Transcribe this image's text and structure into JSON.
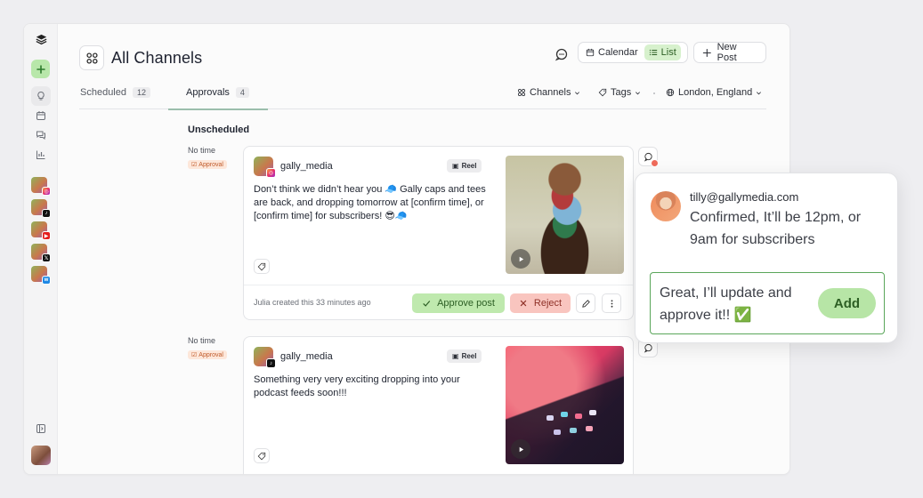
{
  "page": {
    "title": "All Channels"
  },
  "header": {
    "view_calendar": "Calendar",
    "view_list": "List",
    "new_post": "New Post"
  },
  "tabs": [
    {
      "label": "Scheduled",
      "count": "12"
    },
    {
      "label": "Approvals",
      "count": "4"
    }
  ],
  "filters": {
    "channels": "Channels",
    "tags": "Tags",
    "location": "London, England"
  },
  "section": {
    "title": "Unscheduled"
  },
  "posts": [
    {
      "time": "No time",
      "status": "Approval",
      "handle": "gally_media",
      "network": "instagram",
      "format": "Reel",
      "caption": "Don’t think we didn’t hear you 🧢 Gally caps and tees are back, and dropping tomorrow at [confirm time], or [confirm time] for subscribers! 😎🧢",
      "created": "Julia created this 33 minutes ago",
      "approve_label": "Approve post",
      "reject_label": "Reject"
    },
    {
      "time": "No time",
      "status": "Approval",
      "handle": "gally_media",
      "network": "tiktok",
      "format": "Reel",
      "caption": "Something very very exciting dropping into your podcast feeds soon!!!"
    }
  ],
  "comment": {
    "author": "tilly@gallymedia.com",
    "text": "Confirmed, It’ll be 12pm, or 9am for subscribers",
    "reply": "Great, I’ll update and approve it!! ✅",
    "add_label": "Add"
  },
  "sidebar": {
    "channels": [
      {
        "name": "instagram",
        "badge": "◎"
      },
      {
        "name": "tiktok",
        "badge": "♪"
      },
      {
        "name": "youtube",
        "badge": "▶"
      },
      {
        "name": "x",
        "badge": "𝕏"
      },
      {
        "name": "bluesky",
        "badge": "w"
      }
    ]
  },
  "colors": {
    "accent_green": "#bfe9ae",
    "reject_red": "#f9c5bf",
    "approval_orange": "#c05a2a"
  }
}
